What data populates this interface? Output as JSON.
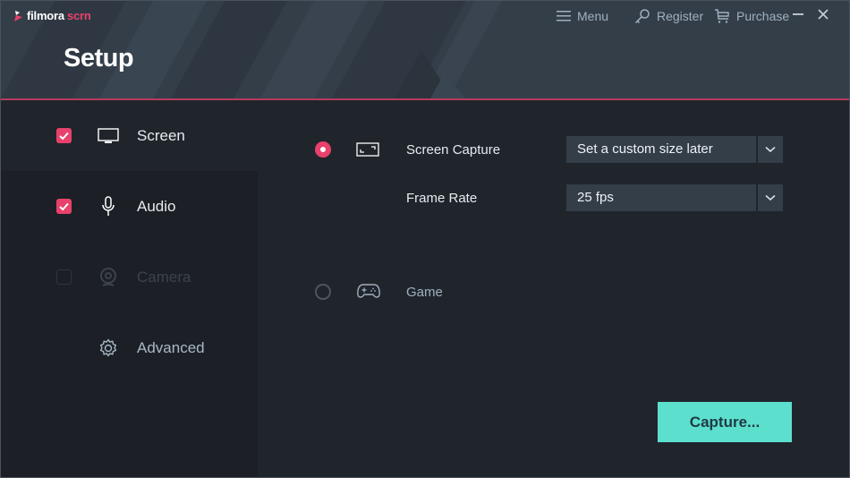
{
  "app": {
    "logo_primary": "filmora",
    "logo_secondary": "scrn",
    "title": "Setup"
  },
  "topnav": {
    "menu_label": "Menu",
    "register_label": "Register",
    "purchase_label": "Purchase"
  },
  "sidebar": {
    "items": [
      {
        "label": "Screen",
        "checked": true,
        "icon": "monitor-icon"
      },
      {
        "label": "Audio",
        "checked": true,
        "icon": "microphone-icon"
      },
      {
        "label": "Camera",
        "checked": false,
        "disabled": true,
        "icon": "webcam-icon"
      },
      {
        "label": "Advanced",
        "icon": "gear-icon"
      }
    ]
  },
  "main": {
    "screen_capture": {
      "label": "Screen Capture",
      "selected": true,
      "icon": "fullscreen-icon",
      "size_value": "Set a custom size later"
    },
    "frame_rate": {
      "label": "Frame Rate",
      "value": "25 fps"
    },
    "game": {
      "label": "Game",
      "selected": false,
      "icon": "gamepad-icon"
    },
    "capture_button": "Capture..."
  },
  "colors": {
    "accent": "#e8416c",
    "capture_button": "#5ddfce",
    "header_bg": "#343e49",
    "body_bg": "#20252c"
  }
}
